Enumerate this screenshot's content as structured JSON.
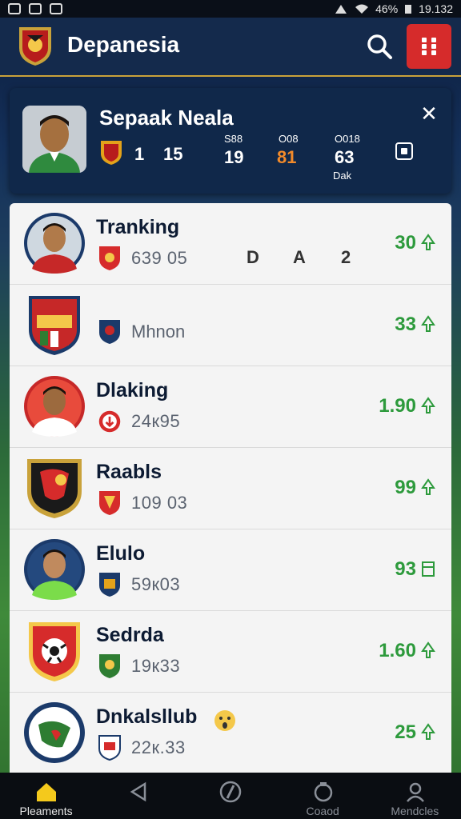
{
  "status_bar": {
    "battery": "46%",
    "time": "19.132"
  },
  "app_bar": {
    "title": "Depanesia"
  },
  "profile": {
    "name": "Sepaak Neala",
    "stat_rank": "1",
    "stat_points": "15",
    "stat_a_label": "S88",
    "stat_a_value": "19",
    "stat_b_label": "O08",
    "stat_b_value": "81",
    "stat_c_label": "O018",
    "stat_c_value": "63",
    "stat_c_sub": "Dak"
  },
  "list": [
    {
      "title": "Tranking",
      "sub": "639 05",
      "value": "30",
      "center": [
        "D",
        "A",
        "2"
      ]
    },
    {
      "title": "",
      "sub": "Mhnon",
      "value": "33"
    },
    {
      "title": "Dlaking",
      "sub": "24к95",
      "value": "1.90"
    },
    {
      "title": "Raabls",
      "sub": "109 03",
      "value": "99"
    },
    {
      "title": "Elulo",
      "sub": "59к03",
      "value": "93"
    },
    {
      "title": "Sedrda",
      "sub": "19к33",
      "value": "1.60"
    },
    {
      "title": "Dnkalsllub",
      "sub": "22к.33",
      "value": "25"
    }
  ],
  "nav": [
    {
      "label": "Pleaments",
      "icon": "home-icon",
      "active": true
    },
    {
      "label": "",
      "icon": "back-icon"
    },
    {
      "label": "",
      "icon": "ball-icon"
    },
    {
      "label": "Coaod",
      "icon": "shield-icon"
    },
    {
      "label": "Mendcles",
      "icon": "people-icon"
    }
  ],
  "colors": {
    "accent": "#d62b2b",
    "value_green": "#2d9a3c",
    "header_bg": "#142a4c"
  }
}
